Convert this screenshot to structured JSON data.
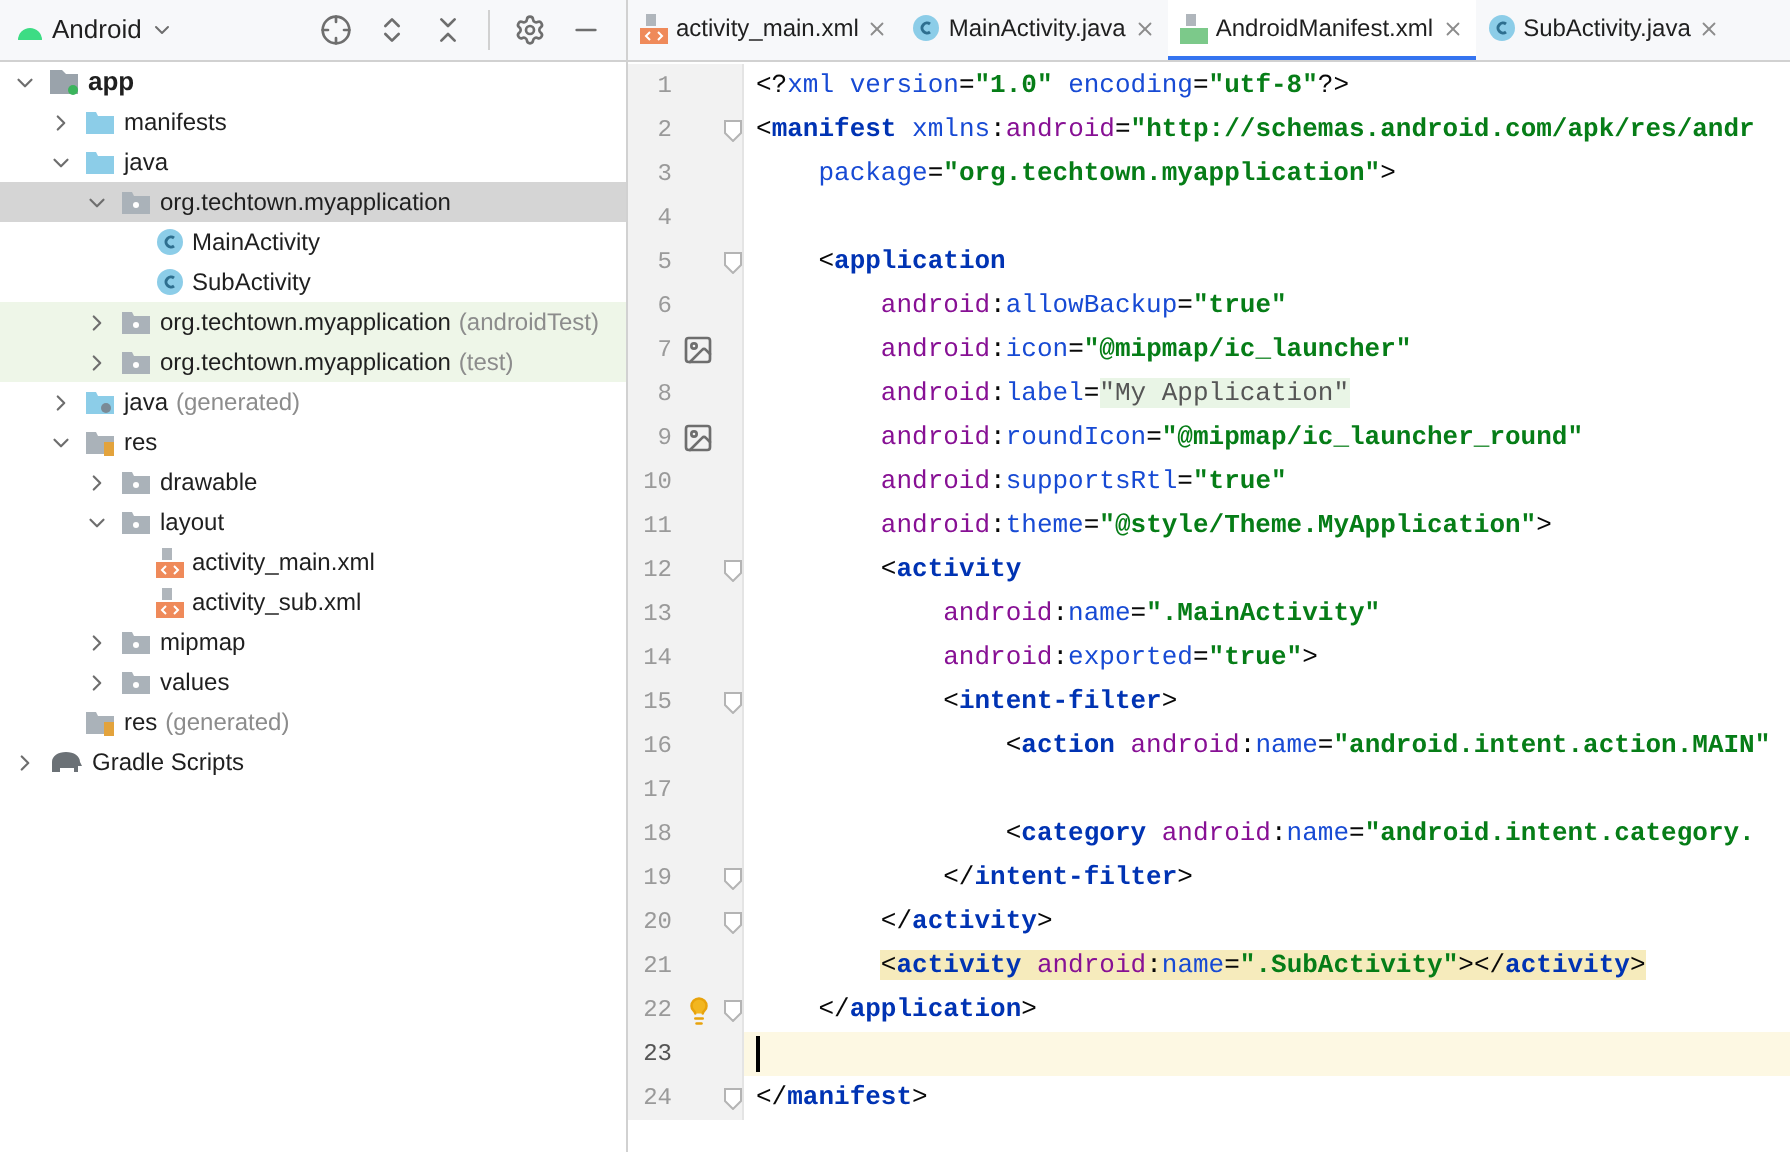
{
  "sidebar": {
    "view": "Android",
    "tree": [
      {
        "label": "app",
        "kind": "module",
        "expanded": true,
        "selected": false,
        "test": false,
        "children": [
          {
            "label": "manifests",
            "kind": "folder",
            "expanded": false,
            "selected": false,
            "test": false
          },
          {
            "label": "java",
            "kind": "folder",
            "expanded": true,
            "selected": false,
            "test": false,
            "children": [
              {
                "label": "org.techtown.myapplication",
                "kind": "package",
                "expanded": true,
                "selected": true,
                "test": false,
                "children": [
                  {
                    "label": "MainActivity",
                    "kind": "class",
                    "selected": false,
                    "test": false
                  },
                  {
                    "label": "SubActivity",
                    "kind": "class",
                    "selected": false,
                    "test": false
                  }
                ]
              },
              {
                "label": "org.techtown.myapplication",
                "note": "(androidTest)",
                "kind": "package",
                "expanded": false,
                "selected": false,
                "test": true
              },
              {
                "label": "org.techtown.myapplication",
                "note": "(test)",
                "kind": "package",
                "expanded": false,
                "selected": false,
                "test": true
              }
            ]
          },
          {
            "label": "java",
            "note": "(generated)",
            "kind": "genfolder",
            "expanded": false,
            "selected": false,
            "test": false
          },
          {
            "label": "res",
            "kind": "res",
            "expanded": true,
            "selected": false,
            "test": false,
            "children": [
              {
                "label": "drawable",
                "kind": "package",
                "expanded": false,
                "selected": false,
                "test": false
              },
              {
                "label": "layout",
                "kind": "package",
                "expanded": true,
                "selected": false,
                "test": false,
                "children": [
                  {
                    "label": "activity_main.xml",
                    "kind": "xml",
                    "selected": false,
                    "test": false
                  },
                  {
                    "label": "activity_sub.xml",
                    "kind": "xml",
                    "selected": false,
                    "test": false
                  }
                ]
              },
              {
                "label": "mipmap",
                "kind": "package",
                "expanded": false,
                "selected": false,
                "test": false
              },
              {
                "label": "values",
                "kind": "package",
                "expanded": false,
                "selected": false,
                "test": false
              }
            ]
          },
          {
            "label": "res",
            "note": "(generated)",
            "kind": "res",
            "selected": false,
            "test": false
          }
        ]
      },
      {
        "label": "Gradle Scripts",
        "kind": "gradle",
        "expanded": false,
        "selected": false,
        "test": false
      }
    ]
  },
  "tabs": [
    {
      "label": "activity_main.xml",
      "kind": "xml",
      "selected": false
    },
    {
      "label": "MainActivity.java",
      "kind": "class",
      "selected": false
    },
    {
      "label": "AndroidManifest.xml",
      "kind": "manifest",
      "selected": true
    },
    {
      "label": "SubActivity.java",
      "kind": "class",
      "selected": false
    }
  ],
  "editor": {
    "lines": [
      {
        "number": "1",
        "tokens": [
          {
            "kind": "p",
            "text": "<?"
          },
          {
            "kind": "kw",
            "text": "xml version"
          },
          {
            "kind": "p",
            "text": "="
          },
          {
            "kind": "str",
            "text": "\"1.0\""
          },
          {
            "kind": "kw",
            "text": " encoding"
          },
          {
            "kind": "p",
            "text": "="
          },
          {
            "kind": "str",
            "text": "\"utf-8\""
          },
          {
            "kind": "p",
            "text": "?>"
          }
        ]
      },
      {
        "number": "2",
        "fold": true,
        "tokens": [
          {
            "kind": "p",
            "text": "<"
          },
          {
            "kind": "tag",
            "text": "manifest"
          },
          {
            "kind": "attr",
            "text": " xmlns"
          },
          {
            "kind": "p",
            "text": ":"
          },
          {
            "kind": "ns",
            "text": "android"
          },
          {
            "kind": "p",
            "text": "="
          },
          {
            "kind": "str",
            "text": "\"http://schemas.android.com/apk/res/andr"
          }
        ]
      },
      {
        "number": "3",
        "tokens": [
          {
            "kind": "attr",
            "text": "    package"
          },
          {
            "kind": "p",
            "text": "="
          },
          {
            "kind": "str",
            "text": "\"org.techtown.myapplication\""
          },
          {
            "kind": "p",
            "text": ">"
          }
        ]
      },
      {
        "number": "4"
      },
      {
        "number": "5",
        "fold": true,
        "tokens": [
          {
            "kind": "p",
            "text": "    <"
          },
          {
            "kind": "tag",
            "text": "application"
          }
        ]
      },
      {
        "number": "6",
        "tokens": [
          {
            "kind": "ns",
            "text": "        android"
          },
          {
            "kind": "p",
            "text": ":"
          },
          {
            "kind": "attr",
            "text": "allowBackup"
          },
          {
            "kind": "p",
            "text": "="
          },
          {
            "kind": "str",
            "text": "\"true\""
          }
        ]
      },
      {
        "number": "7",
        "gutter": {
          "kind": "image"
        },
        "tokens": [
          {
            "kind": "ns",
            "text": "        android"
          },
          {
            "kind": "p",
            "text": ":"
          },
          {
            "kind": "attr",
            "text": "icon"
          },
          {
            "kind": "p",
            "text": "="
          },
          {
            "kind": "str",
            "text": "\"@mipmap/ic_launcher\""
          }
        ]
      },
      {
        "number": "8",
        "tokens": [
          {
            "kind": "ns",
            "text": "        android"
          },
          {
            "kind": "p",
            "text": ":"
          },
          {
            "kind": "attr",
            "text": "label"
          },
          {
            "kind": "p",
            "text": "="
          },
          {
            "kind": "folded",
            "text": "\"My Application\""
          }
        ]
      },
      {
        "number": "9",
        "gutter": {
          "kind": "image"
        },
        "tokens": [
          {
            "kind": "ns",
            "text": "        android"
          },
          {
            "kind": "p",
            "text": ":"
          },
          {
            "kind": "attr",
            "text": "roundIcon"
          },
          {
            "kind": "p",
            "text": "="
          },
          {
            "kind": "str",
            "text": "\"@mipmap/ic_launcher_round\""
          }
        ]
      },
      {
        "number": "10",
        "tokens": [
          {
            "kind": "ns",
            "text": "        android"
          },
          {
            "kind": "p",
            "text": ":"
          },
          {
            "kind": "attr",
            "text": "supportsRtl"
          },
          {
            "kind": "p",
            "text": "="
          },
          {
            "kind": "str",
            "text": "\"true\""
          }
        ]
      },
      {
        "number": "11",
        "tokens": [
          {
            "kind": "ns",
            "text": "        android"
          },
          {
            "kind": "p",
            "text": ":"
          },
          {
            "kind": "attr",
            "text": "theme"
          },
          {
            "kind": "p",
            "text": "="
          },
          {
            "kind": "str",
            "text": "\"@style/Theme.MyApplication\""
          },
          {
            "kind": "p",
            "text": ">"
          }
        ]
      },
      {
        "number": "12",
        "fold": true,
        "tokens": [
          {
            "kind": "p",
            "text": "        <"
          },
          {
            "kind": "tag",
            "text": "activity"
          }
        ]
      },
      {
        "number": "13",
        "tokens": [
          {
            "kind": "ns",
            "text": "            android"
          },
          {
            "kind": "p",
            "text": ":"
          },
          {
            "kind": "attr",
            "text": "name"
          },
          {
            "kind": "p",
            "text": "="
          },
          {
            "kind": "str",
            "text": "\".MainActivity\""
          }
        ]
      },
      {
        "number": "14",
        "tokens": [
          {
            "kind": "ns",
            "text": "            android"
          },
          {
            "kind": "p",
            "text": ":"
          },
          {
            "kind": "attr",
            "text": "exported"
          },
          {
            "kind": "p",
            "text": "="
          },
          {
            "kind": "str",
            "text": "\"true\""
          },
          {
            "kind": "p",
            "text": ">"
          }
        ]
      },
      {
        "number": "15",
        "fold": true,
        "tokens": [
          {
            "kind": "p",
            "text": "            <"
          },
          {
            "kind": "tag",
            "text": "intent-filter"
          },
          {
            "kind": "p",
            "text": ">"
          }
        ]
      },
      {
        "number": "16",
        "tokens": [
          {
            "kind": "p",
            "text": "                <"
          },
          {
            "kind": "tag",
            "text": "action"
          },
          {
            "kind": "ns",
            "text": " android"
          },
          {
            "kind": "p",
            "text": ":"
          },
          {
            "kind": "attr",
            "text": "name"
          },
          {
            "kind": "p",
            "text": "="
          },
          {
            "kind": "str",
            "text": "\"android.intent.action.MAIN\""
          }
        ]
      },
      {
        "number": "17"
      },
      {
        "number": "18",
        "tokens": [
          {
            "kind": "p",
            "text": "                <"
          },
          {
            "kind": "tag",
            "text": "category"
          },
          {
            "kind": "ns",
            "text": " android"
          },
          {
            "kind": "p",
            "text": ":"
          },
          {
            "kind": "attr",
            "text": "name"
          },
          {
            "kind": "p",
            "text": "="
          },
          {
            "kind": "str",
            "text": "\"android.intent.category."
          }
        ]
      },
      {
        "number": "19",
        "fold": true,
        "tokens": [
          {
            "kind": "p",
            "text": "            </"
          },
          {
            "kind": "tag",
            "text": "intent-filter"
          },
          {
            "kind": "p",
            "text": ">"
          }
        ]
      },
      {
        "number": "20",
        "fold": true,
        "tokens": [
          {
            "kind": "p",
            "text": "        </"
          },
          {
            "kind": "tag",
            "text": "activity"
          },
          {
            "kind": "p",
            "text": ">"
          }
        ]
      },
      {
        "number": "21",
        "highlight": true,
        "tokens": [
          {
            "kind": "p",
            "text": "        <"
          },
          {
            "kind": "tag",
            "text": "activity"
          },
          {
            "kind": "ns",
            "text": " android"
          },
          {
            "kind": "p",
            "text": ":"
          },
          {
            "kind": "attr",
            "text": "name"
          },
          {
            "kind": "p",
            "text": "="
          },
          {
            "kind": "str",
            "text": "\".SubActivity\""
          },
          {
            "kind": "p",
            "text": "></"
          },
          {
            "kind": "tag",
            "text": "activity"
          },
          {
            "kind": "p",
            "text": ">"
          }
        ]
      },
      {
        "number": "22",
        "fold": true,
        "gutter": {
          "kind": "bulb"
        },
        "tokens": [
          {
            "kind": "p",
            "text": "    </"
          },
          {
            "kind": "tag",
            "text": "application"
          },
          {
            "kind": "p",
            "text": ">"
          }
        ]
      },
      {
        "number": "23",
        "current": true
      },
      {
        "number": "24",
        "fold": true,
        "tokens": [
          {
            "kind": "p",
            "text": "</"
          },
          {
            "kind": "tag",
            "text": "manifest"
          },
          {
            "kind": "p",
            "text": ">"
          }
        ]
      }
    ]
  }
}
